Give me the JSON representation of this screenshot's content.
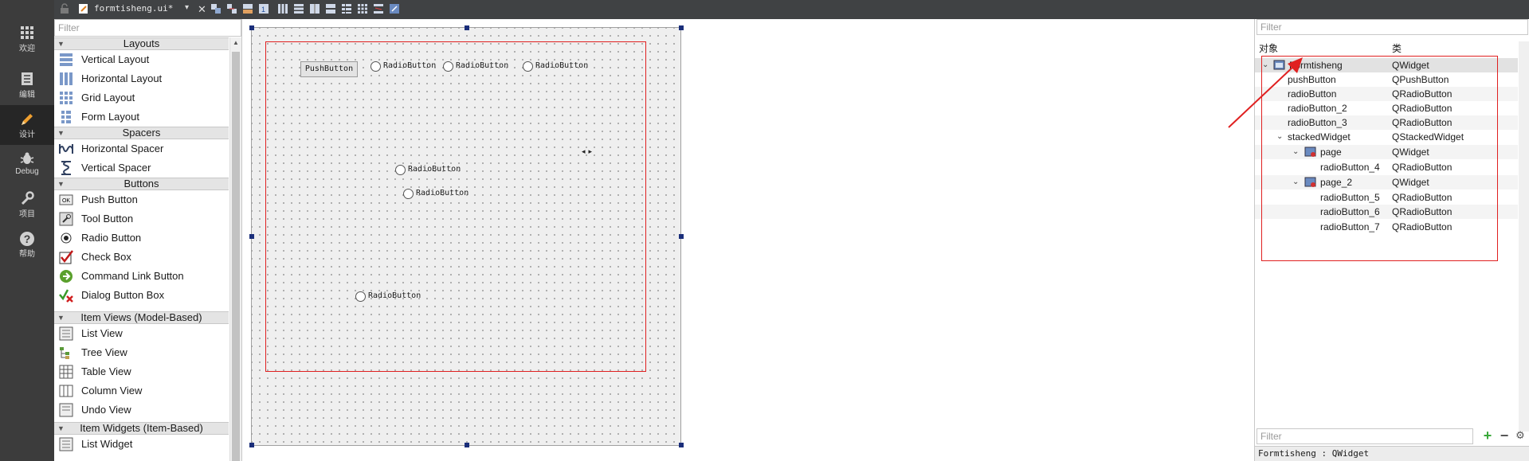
{
  "mode_bar": {
    "items": [
      {
        "label": "欢迎",
        "icon": "grid-icon"
      },
      {
        "label": "编辑",
        "icon": "document-icon"
      },
      {
        "label": "设计",
        "icon": "pencil-icon",
        "active": true
      },
      {
        "label": "Debug",
        "icon": "bug-icon"
      },
      {
        "label": "项目",
        "icon": "wrench-icon"
      },
      {
        "label": "帮助",
        "icon": "help-icon"
      }
    ]
  },
  "toolbar": {
    "file_name": "formtisheng.ui*"
  },
  "widget_box": {
    "filter_placeholder": "Filter",
    "categories": {
      "layouts": "Layouts",
      "spacers": "Spacers",
      "buttons": "Buttons",
      "item_views": "Item Views (Model-Based)",
      "item_widgets": "Item Widgets (Item-Based)"
    },
    "items": {
      "vertical_layout": "Vertical Layout",
      "horizontal_layout": "Horizontal Layout",
      "grid_layout": "Grid Layout",
      "form_layout": "Form Layout",
      "horizontal_spacer": "Horizontal Spacer",
      "vertical_spacer": "Vertical Spacer",
      "push_button": "Push Button",
      "tool_button": "Tool Button",
      "radio_button": "Radio Button",
      "check_box": "Check Box",
      "command_link_button": "Command Link Button",
      "dialog_button_box": "Dialog Button Box",
      "list_view": "List View",
      "tree_view": "Tree View",
      "table_view": "Table View",
      "column_view": "Column View",
      "undo_view": "Undo View",
      "list_widget": "List Widget"
    }
  },
  "form": {
    "push_button": "PushButton",
    "radio_1": "RadioButton",
    "radio_2": "RadioButton",
    "radio_3": "RadioButton",
    "radio_4": "RadioButton",
    "radio_5": "RadioButton",
    "radio_6": "RadioButton"
  },
  "inspector": {
    "filter_placeholder": "Filter",
    "col_object": "对象",
    "col_class": "类",
    "rows": [
      {
        "object": "Formtisheng",
        "class": "QWidget"
      },
      {
        "object": "pushButton",
        "class": "QPushButton"
      },
      {
        "object": "radioButton",
        "class": "QRadioButton"
      },
      {
        "object": "radioButton_2",
        "class": "QRadioButton"
      },
      {
        "object": "radioButton_3",
        "class": "QRadioButton"
      },
      {
        "object": "stackedWidget",
        "class": "QStackedWidget"
      },
      {
        "object": "page",
        "class": "QWidget"
      },
      {
        "object": "radioButton_4",
        "class": "QRadioButton"
      },
      {
        "object": "page_2",
        "class": "QWidget"
      },
      {
        "object": "radioButton_5",
        "class": "QRadioButton"
      },
      {
        "object": "radioButton_6",
        "class": "QRadioButton"
      },
      {
        "object": "radioButton_7",
        "class": "QRadioButton"
      }
    ],
    "bottom_filter_placeholder": "Filter",
    "status_text": "Formtisheng : QWidget"
  },
  "colors": {
    "annotation_red": "#e02020",
    "handle_blue": "#1a2e7a",
    "mode_bar_bg": "#3c3c3c"
  }
}
